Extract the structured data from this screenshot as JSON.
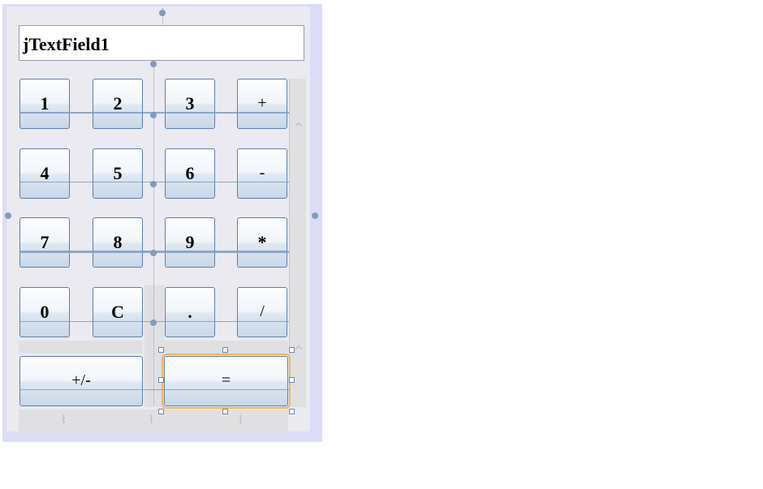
{
  "form": {
    "text_field": {
      "value": "jTextField1"
    }
  },
  "buttons": [
    {
      "id": "btn-1",
      "label": "1"
    },
    {
      "id": "btn-2",
      "label": "2"
    },
    {
      "id": "btn-3",
      "label": "3"
    },
    {
      "id": "btn-plus",
      "label": "+"
    },
    {
      "id": "btn-4",
      "label": "4"
    },
    {
      "id": "btn-5",
      "label": "5"
    },
    {
      "id": "btn-6",
      "label": "6"
    },
    {
      "id": "btn-minus",
      "label": "-"
    },
    {
      "id": "btn-7",
      "label": "7"
    },
    {
      "id": "btn-8",
      "label": "8"
    },
    {
      "id": "btn-9",
      "label": "9"
    },
    {
      "id": "btn-multiply",
      "label": "*"
    },
    {
      "id": "btn-0",
      "label": "0"
    },
    {
      "id": "btn-clear",
      "label": "C"
    },
    {
      "id": "btn-dot",
      "label": "."
    },
    {
      "id": "btn-divide",
      "label": "/"
    },
    {
      "id": "btn-sign",
      "label": "+/-"
    },
    {
      "id": "btn-equals",
      "label": "="
    }
  ],
  "selection": {
    "selected_button": "="
  },
  "colors": {
    "button_border": "#5f7fa6",
    "selection_outline": "#f2b35a",
    "guide_line": "#7f9bbd"
  }
}
